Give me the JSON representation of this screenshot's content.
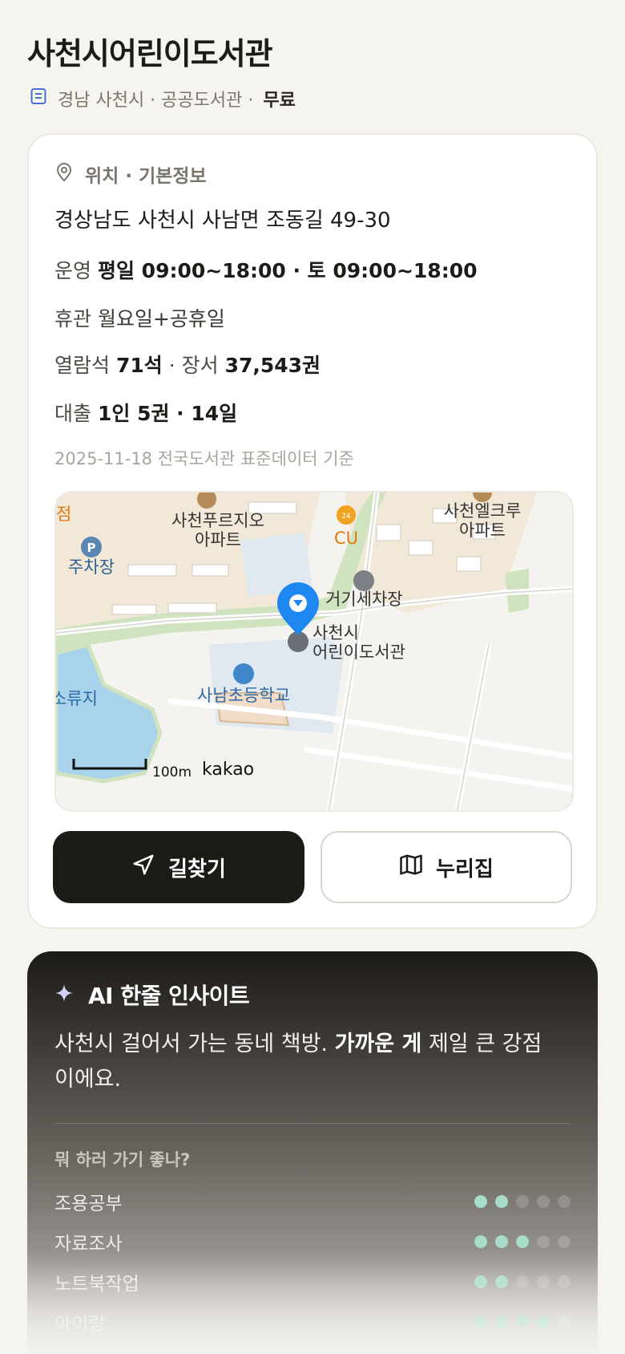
{
  "header": {
    "title": "사천시어린이도서관",
    "meta_location": "경남 사천시 · 공공도서관 ·",
    "meta_fee": "무료"
  },
  "info": {
    "section_title": "위치 · 기본정보",
    "address": "경상남도 사천시 사남면 조동길 49-30",
    "hours_label": "운영",
    "hours_value": "평일 09:00~18:00 · 토 09:00~18:00",
    "closed_label": "휴관",
    "closed_value": "월요일+공휴일",
    "seats_label": "열람석",
    "seats_value": "71석",
    "books_label": "· 장서",
    "books_value": "37,543권",
    "loan_label": "대출",
    "loan_value": "1인 5권 · 14일",
    "source_note": "2025-11-18 전국도서관 표준데이터 기준"
  },
  "map": {
    "labels": {
      "apt1_line1": "사천푸르지오",
      "apt1_line2": "아파트",
      "convenience": "CU",
      "apt2_line1": "사천엘크루",
      "apt2_line2": "아파트",
      "parking": "주차장",
      "carwash": "거기세차장",
      "library_line1": "사천시",
      "library_line2": "어린이도서관",
      "school": "사남초등학교",
      "reservoir": "소류지",
      "edge_store": "점",
      "scale": "100m",
      "provider": "kakao",
      "parking_badge": "P",
      "cu_badge": "24"
    }
  },
  "actions": {
    "directions_label": "길찾기",
    "nurijip_label": "누리집"
  },
  "ai": {
    "title": "AI 한줄 인사이트",
    "summary_prefix": "사천시 걸어서 가는 동네 책방.",
    "summary_bold": "가까운 게",
    "summary_suffix": "제일 큰 강점이에요.",
    "activities_title": "뭐 하러 가기 좋나?",
    "activities": [
      {
        "name": "조용공부",
        "score": 2,
        "max": 5
      },
      {
        "name": "자료조사",
        "score": 3,
        "max": 5
      },
      {
        "name": "노트북작업",
        "score": 2,
        "max": 5
      },
      {
        "name": "아이랑",
        "score": 4,
        "max": 5
      }
    ]
  },
  "colors": {
    "accent_pin": "#1e88f0",
    "rating_on": "#a7dccb",
    "primary_button": "#1d1b18"
  }
}
